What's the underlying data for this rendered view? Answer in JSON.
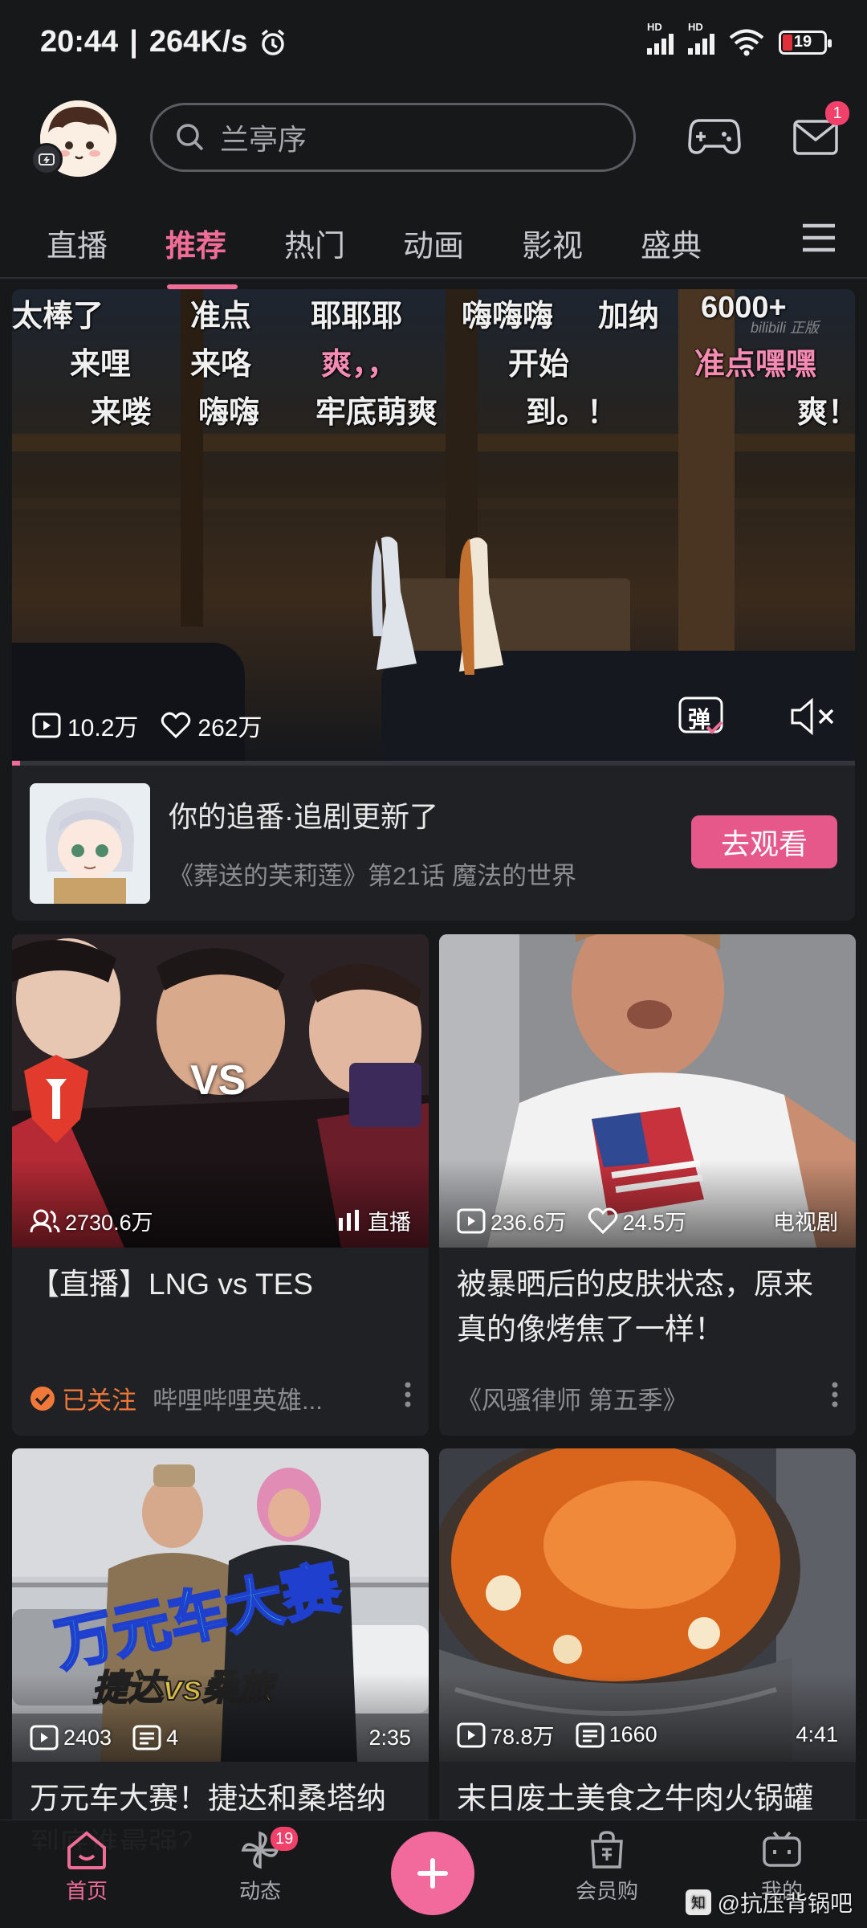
{
  "status_bar": {
    "time": "20:44",
    "speed": "264K/s",
    "battery": "19",
    "network_label": "HD"
  },
  "header": {
    "search_placeholder": "兰亭序",
    "message_badge": "1"
  },
  "tabs": [
    {
      "label": "直播",
      "active": false
    },
    {
      "label": "推荐",
      "active": true
    },
    {
      "label": "热门",
      "active": false
    },
    {
      "label": "动画",
      "active": false
    },
    {
      "label": "影视",
      "active": false
    },
    {
      "label": "盛典",
      "active": false
    }
  ],
  "hero": {
    "danmaku": [
      "太棒了",
      "准点",
      "耶耶耶",
      "嗨嗨嗨",
      "加纳",
      "6000+",
      "来哩",
      "来咯",
      "爽，，",
      "开始",
      "准点嘿嘿",
      "来喽",
      "嗨嗨",
      "牢底萌爽",
      "到。！",
      "爽！"
    ],
    "watermark": "bilibili 正版",
    "plays": "10.2万",
    "likes": "262万",
    "danmaku_button": "弹"
  },
  "follow_card": {
    "title": "你的追番·追剧更新了",
    "subtitle": "《葬送的芙莉莲》第21话 魔法的世界",
    "button": "去观看"
  },
  "feed": [
    {
      "cover_text": "VS",
      "stat1": "2730.6万",
      "tag": "直播",
      "title": "【直播】LNG vs TES",
      "followed": "已关注",
      "author": "哔哩哔哩英雄..."
    },
    {
      "stat1": "236.6万",
      "stat2": "24.5万",
      "tag": "电视剧",
      "title": "被暴晒后的皮肤状态，原来真的像烤焦了一样！",
      "source": "《风骚律师 第五季》"
    },
    {
      "cover_text_1": "万元车大赛",
      "cover_text_2": "捷达vs桑旅",
      "stat1": "2403",
      "stat2": "4",
      "duration": "2:35",
      "title": "万元车大赛！捷达和桑塔纳到底谁最强？"
    },
    {
      "stat1": "78.8万",
      "stat2": "1660",
      "duration": "4:41",
      "title": "末日废土美食之牛肉火锅罐"
    }
  ],
  "bottom_nav": {
    "home": "首页",
    "dynamic": "动态",
    "dynamic_badge": "19",
    "vip_shop": "会员购",
    "mine": "我的"
  },
  "watermark": "@抗压背锅吧",
  "colors": {
    "accent": "#f06d97",
    "button": "#e7588a",
    "followed": "#f07839",
    "background": "#17181a",
    "card": "#202124"
  }
}
